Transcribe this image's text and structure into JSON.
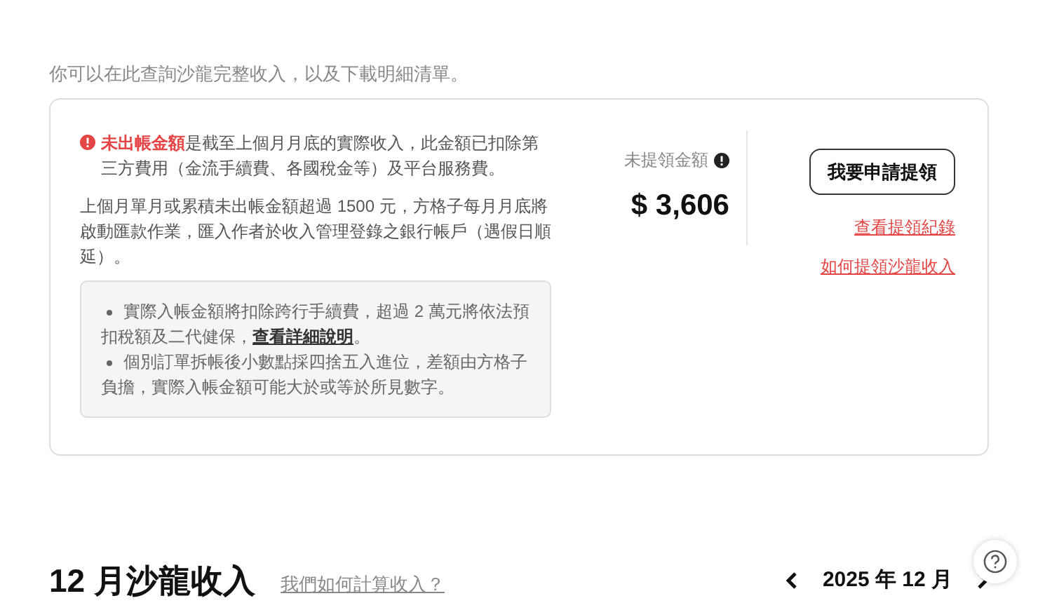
{
  "intro": "你可以在此查詢沙龍完整收入，以及下載明細清單。",
  "notice": {
    "highlight": "未出帳金額",
    "text": "是截至上個月月底的實際收入，此金額已扣除第三方費用（金流手續費、各國稅金等）及平台服務費。"
  },
  "payout_note": "上個月單月或累積未出帳金額超過 1500 元，方格子每月月底將啟動匯款作業，匯入作者於收入管理登錄之銀行帳戶（遇假日順延）。",
  "bullets": [
    {
      "before": "實際入帳金額將扣除跨行手續費，超過 2 萬元將依法預扣稅額及二代健保，",
      "link": "查看詳細說明",
      "after": "。"
    },
    {
      "before": "個別訂單拆帳後小數點採四捨五入進位，差額由方格子負擔，實際入帳金額可能大於或等於所見數字。"
    }
  ],
  "balance": {
    "label": "未提領金額",
    "amount": "$ 3,606"
  },
  "withdraw_button": "我要申請提領",
  "links": [
    "查看提領紀錄",
    "如何提領沙龍收入"
  ],
  "section": {
    "title": "12 月沙龍收入",
    "help_link": "我們如何計算收入？",
    "month": "2025 年 12 月"
  }
}
